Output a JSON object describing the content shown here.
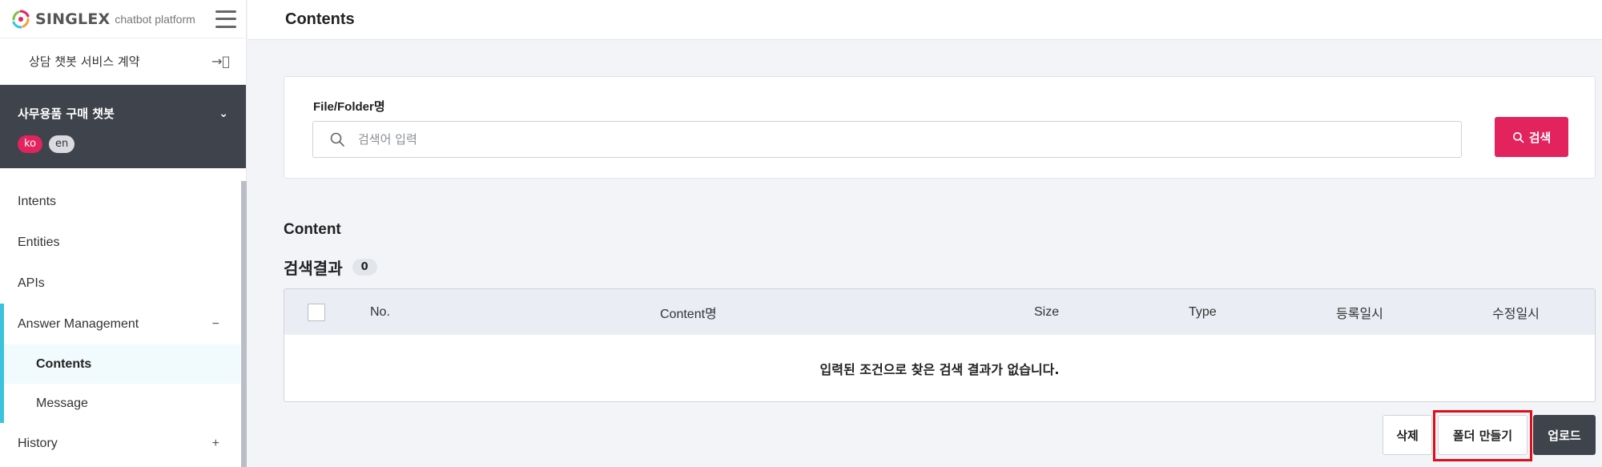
{
  "brand": {
    "logo_text": "SINGLEX",
    "logo_sub": "chatbot platform"
  },
  "sidebar": {
    "contract_label": "상담 챗봇 서비스 계약",
    "bot_name": "사무용품 구매 챗봇",
    "languages": [
      {
        "code": "ko",
        "active": true
      },
      {
        "code": "en",
        "active": false
      }
    ],
    "menu": {
      "intents": "Intents",
      "entities": "Entities",
      "apis": "APIs",
      "answer_management": "Answer Management",
      "answer_management_toggle": "−",
      "contents": "Contents",
      "message": "Message",
      "history": "History",
      "history_toggle": "+"
    }
  },
  "header": {
    "title": "Contents"
  },
  "search": {
    "label": "File/Folder명",
    "placeholder": "검색어 입력",
    "button_label": "검색"
  },
  "results": {
    "section_title": "Content",
    "result_label": "검색결과",
    "count": "0",
    "columns": [
      "No.",
      "Content명",
      "Size",
      "Type",
      "등록일시",
      "수정일시"
    ],
    "empty_message": "입력된 조건으로 찾은 검색 결과가 없습니다."
  },
  "actions": {
    "delete_label": "삭제",
    "create_folder_label": "폴더 만들기",
    "upload_label": "업로드"
  },
  "colors": {
    "accent": "#e2235e",
    "dark_panel": "#3f434b",
    "active_marker": "#3bc3de",
    "highlight": "#e00d1a"
  }
}
